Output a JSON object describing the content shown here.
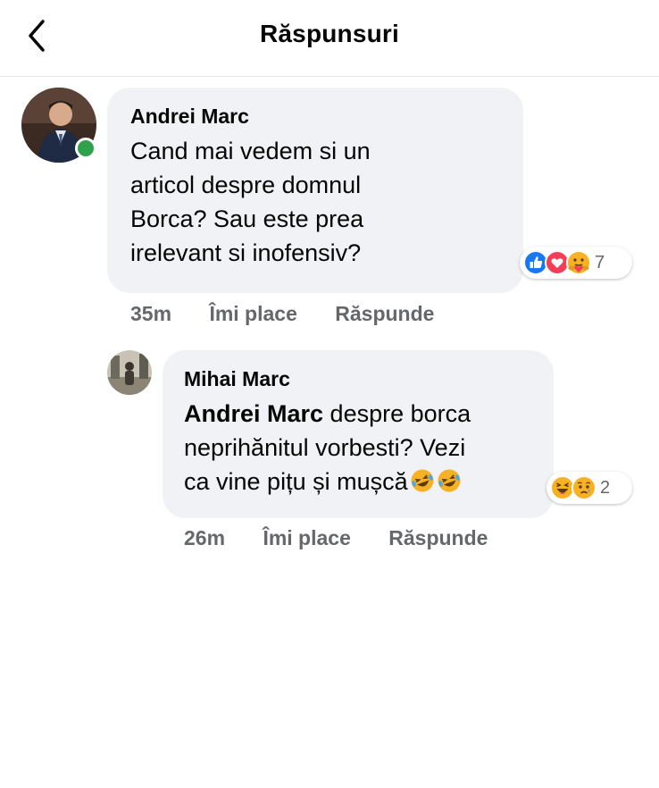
{
  "header": {
    "title": "Răspunsuri",
    "back_icon": "chevron-left-icon"
  },
  "comments": [
    {
      "author": "Andrei Marc",
      "text": "Cand mai vedem si un articol despre domnul Borca? Sau este prea irelevant si inofensiv?",
      "lines": [
        "Cand mai vedem si un",
        "articol despre domnul",
        "Borca? Sau este prea",
        "irelevant si inofensiv?"
      ],
      "online": true,
      "time": "35m",
      "like_label": "Îmi place",
      "reply_label": "Răspunde",
      "reactions": {
        "icons": [
          "like-reaction-icon",
          "love-reaction-icon",
          "care-reaction-icon"
        ],
        "count": "7"
      }
    },
    {
      "author": "Mihai Marc",
      "mention": "Andrei Marc",
      "line1_rest": " despre borca",
      "lines": [
        "neprihănitul vorbesti? Vezi",
        "ca vine pițu și mușcă"
      ],
      "inline_emojis": [
        "rolling-laughing-emoji",
        "rolling-laughing-emoji"
      ],
      "time": "26m",
      "like_label": "Îmi place",
      "reply_label": "Răspunde",
      "reactions": {
        "icons": [
          "haha-reaction-icon",
          "sad-reaction-icon"
        ],
        "count": "2"
      }
    }
  ],
  "colors": {
    "bubble": "#f0f2f5",
    "meta": "#65676b",
    "online": "#31a24c",
    "like": "#1877f2",
    "love": "#f33e58"
  }
}
